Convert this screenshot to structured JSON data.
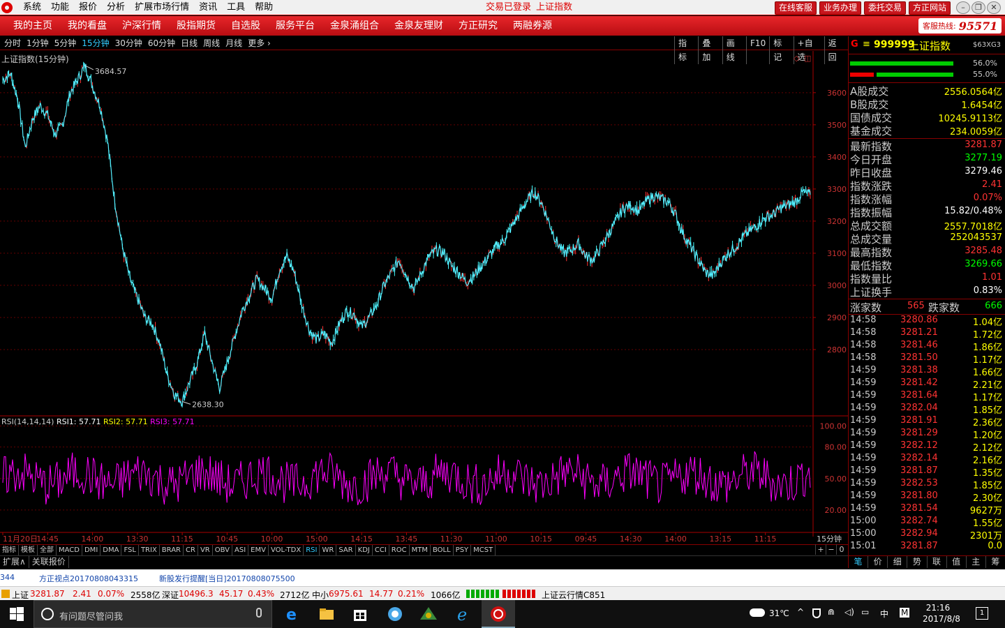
{
  "titlebar": {
    "menus": [
      "系统",
      "功能",
      "报价",
      "分析",
      "扩展市场行情",
      "资讯",
      "工具",
      "帮助"
    ],
    "login_status": "交易已登录",
    "index_name": "上证指数",
    "buttons": [
      "在线客服",
      "业务办理",
      "委托交易",
      "方正网站"
    ]
  },
  "nav": {
    "items": [
      "我的主页",
      "我的看盘",
      "沪深行情",
      "股指期货",
      "自选股",
      "服务平台",
      "金泉涌组合",
      "金泉友理财",
      "方正研究",
      "两融券源"
    ],
    "hotline_label": "客服热线:",
    "hotline_number": "95571"
  },
  "periodbar": {
    "periods": [
      "分时",
      "1分钟",
      "5分钟",
      "15分钟",
      "30分钟",
      "60分钟",
      "日线",
      "周线",
      "月线",
      "更多 ›"
    ],
    "active_period": "15分钟",
    "tools": [
      "指标",
      "叠加",
      "画线",
      "F10",
      "标记",
      "+自选",
      "返回"
    ]
  },
  "chart": {
    "title": "上证指数(15分钟)",
    "high_label": "3684.57",
    "low_label": "2638.30",
    "rsi_title": "RSI(14,14,14)",
    "rsi1_label": "RSI1: 57.71",
    "rsi2_label": "RSI2: 57.71",
    "rsi3_label": "RSI3: 57.71",
    "period_tag": "15分钟"
  },
  "chart_data": {
    "type": "line",
    "title": "上证指数(15分钟)",
    "y_ticks": [
      3600,
      3500,
      3400,
      3300,
      3200,
      3100,
      3000,
      2900,
      2800
    ],
    "ylim": [
      2600,
      3730
    ],
    "x_ticks": [
      "11月20日",
      "14:45",
      "14:00",
      "13:30",
      "11:15",
      "10:45",
      "10:00",
      "15:00",
      "14:15",
      "13:45",
      "11:30",
      "11:00",
      "10:15",
      "09:45",
      "14:30",
      "14:00",
      "13:15",
      "11:15"
    ],
    "series": [
      {
        "values": [
          3640,
          3660,
          3580,
          3430,
          3520,
          3560,
          3530,
          3470,
          3500,
          3600,
          3640,
          3684.57,
          3620,
          3560,
          3450,
          3260,
          3120,
          3020,
          2960,
          2900,
          2880,
          2820,
          2720,
          2660,
          2638.3,
          2700,
          2760,
          2850,
          2760,
          2680,
          2760,
          2840,
          2920,
          2970,
          3020,
          2990,
          2960,
          3050,
          3090,
          3040,
          2940,
          2860,
          2830,
          2850,
          2820,
          2880,
          2920,
          2910,
          2870,
          2900,
          2940,
          3000,
          3040,
          3080,
          3030,
          2990,
          3040,
          3090,
          3110,
          3100,
          3060,
          3040,
          3010,
          3030,
          3060,
          3090,
          3120,
          3140,
          3180,
          3220,
          3260,
          3290,
          3260,
          3200,
          3140,
          3100,
          3110,
          3130,
          3090,
          3080,
          3120,
          3160,
          3200,
          3240,
          3250,
          3230,
          3260,
          3280,
          3270,
          3260,
          3220,
          3160,
          3120,
          3080,
          3040,
          3030,
          3070,
          3100,
          3120,
          3150,
          3170,
          3190,
          3210,
          3220,
          3240,
          3250,
          3260,
          3290,
          3281.87
        ]
      }
    ],
    "rsi": {
      "name": "RSI(14,14,14)",
      "y_ticks": [
        100,
        80,
        50,
        20
      ],
      "ylim": [
        0,
        105
      ],
      "last_values": [
        57.71,
        57.71,
        57.71
      ]
    }
  },
  "indicator_tabs": [
    "指标",
    "模板",
    "全部",
    "MACD",
    "DMI",
    "DMA",
    "FSL",
    "TRIX",
    "BRAR",
    "CR",
    "VR",
    "OBV",
    "ASI",
    "EMV",
    "VOL-TDX",
    "RSI",
    "WR",
    "SAR",
    "KDJ",
    "CCI",
    "ROC",
    "MTM",
    "BOLL",
    "PSY",
    "MCST"
  ],
  "active_indicator": "RSI",
  "ext_tabs": [
    "扩展∧",
    "关联报价"
  ],
  "zoom_ctrl": [
    "+",
    "−",
    "0"
  ],
  "right_panel": {
    "g": "G",
    "eq": "≡",
    "code": "999999",
    "name": "上证指数",
    "tag": "$63XG3",
    "bar1_pct": "56.0%",
    "bar2_pct": "55.0%",
    "turnover": [
      {
        "k": "A股成交",
        "v": "2556.0564亿"
      },
      {
        "k": "B股成交",
        "v": "1.6454亿"
      },
      {
        "k": "国债成交",
        "v": "10245.9113亿"
      },
      {
        "k": "基金成交",
        "v": "234.0059亿"
      }
    ],
    "stats": [
      {
        "k": "最新指数",
        "v": "3281.87",
        "c": "#f33"
      },
      {
        "k": "今日开盘",
        "v": "3277.19",
        "c": "#0f0"
      },
      {
        "k": "昨日收盘",
        "v": "3279.46",
        "c": "#fff"
      },
      {
        "k": "指数涨跌",
        "v": "2.41",
        "c": "#f33"
      },
      {
        "k": "指数涨幅",
        "v": "0.07%",
        "c": "#f33"
      },
      {
        "k": "指数振幅",
        "v": "15.82/0.48%",
        "c": "#fff"
      },
      {
        "k": "总成交额",
        "v": "2557.7018亿",
        "c": "#ff0"
      },
      {
        "k": "总成交量",
        "v": "252043537",
        "c": "#ff0"
      },
      {
        "k": "最高指数",
        "v": "3285.48",
        "c": "#f33"
      },
      {
        "k": "最低指数",
        "v": "3269.66",
        "c": "#0f0"
      },
      {
        "k": "指数量比",
        "v": "1.01",
        "c": "#f33"
      },
      {
        "k": "上证换手",
        "v": "0.83%",
        "c": "#fff"
      }
    ],
    "adv_label": "涨家数",
    "adv_value": "565",
    "dec_label": "跌家数",
    "dec_value": "666",
    "ticks": [
      {
        "t": "14:58",
        "p": "3280.86",
        "v": "1.04亿",
        "c": "#f33"
      },
      {
        "t": "14:58",
        "p": "3281.21",
        "v": "1.72亿",
        "c": "#f33"
      },
      {
        "t": "14:58",
        "p": "3281.46",
        "v": "1.86亿",
        "c": "#f33"
      },
      {
        "t": "14:58",
        "p": "3281.50",
        "v": "1.17亿",
        "c": "#f33"
      },
      {
        "t": "14:59",
        "p": "3281.38",
        "v": "1.66亿",
        "c": "#f33"
      },
      {
        "t": "14:59",
        "p": "3281.42",
        "v": "2.21亿",
        "c": "#f33"
      },
      {
        "t": "14:59",
        "p": "3281.64",
        "v": "1.17亿",
        "c": "#f33"
      },
      {
        "t": "14:59",
        "p": "3282.04",
        "v": "1.85亿",
        "c": "#f33"
      },
      {
        "t": "14:59",
        "p": "3281.91",
        "v": "2.36亿",
        "c": "#f33"
      },
      {
        "t": "14:59",
        "p": "3281.29",
        "v": "1.20亿",
        "c": "#f33"
      },
      {
        "t": "14:59",
        "p": "3282.12",
        "v": "2.12亿",
        "c": "#f33"
      },
      {
        "t": "14:59",
        "p": "3282.14",
        "v": "2.16亿",
        "c": "#f33"
      },
      {
        "t": "14:59",
        "p": "3281.87",
        "v": "1.35亿",
        "c": "#f33"
      },
      {
        "t": "14:59",
        "p": "3282.53",
        "v": "1.85亿",
        "c": "#f33"
      },
      {
        "t": "14:59",
        "p": "3281.80",
        "v": "2.30亿",
        "c": "#f33"
      },
      {
        "t": "14:59",
        "p": "3281.54",
        "v": "9627万",
        "c": "#f33"
      },
      {
        "t": "15:00",
        "p": "3282.74",
        "v": "1.55亿",
        "c": "#f33"
      },
      {
        "t": "15:00",
        "p": "3282.94",
        "v": "2301万",
        "c": "#f33"
      },
      {
        "t": "15:01",
        "p": "3281.87",
        "v": "0.0",
        "c": "#f33"
      }
    ],
    "tabs": [
      "笔",
      "价",
      "细",
      "势",
      "联",
      "值",
      "主",
      "筹"
    ]
  },
  "news": {
    "item0": "344",
    "item1": "方正视点20170808043315",
    "item2": "新股发行提醒[当日]20170808075500"
  },
  "status": {
    "sh_label": "上证",
    "sh_value": "3281.87",
    "sh_change": "2.41",
    "sh_pct": "0.07%",
    "sh_amount": "2558亿",
    "sz_label": "深证",
    "sz_value": "10496.3",
    "sz_change": "45.17",
    "sz_pct": "0.43%",
    "sz_amount": "2712亿",
    "zx_label": "中小",
    "zx_value": "6975.61",
    "zx_change": "14.77",
    "zx_pct": "0.21%",
    "zx_amount": "1066亿",
    "cloud": "上证云行情C851"
  },
  "taskbar": {
    "search_placeholder": "有问题尽管问我",
    "weather": "31℃",
    "ime": "中",
    "m": "M",
    "time": "21:16",
    "date": "2017/8/8",
    "notif": "1"
  }
}
